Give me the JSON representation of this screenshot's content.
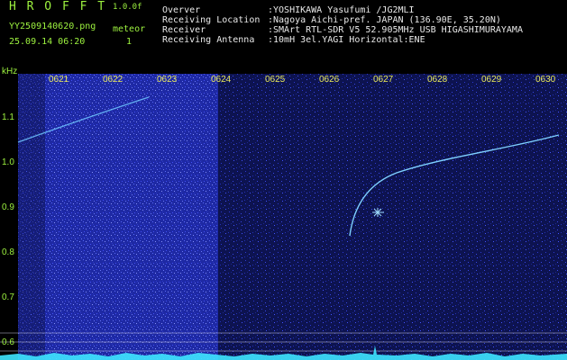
{
  "header": {
    "brand": "H R O F F T",
    "version": "1.0.0f",
    "filename": "YY2509140620.png",
    "datetime": "25.09.14 06:20",
    "meteor_label": "meteor",
    "meteor_count": "1",
    "info_labels": [
      "Overver",
      "Receiving Location",
      "Receiver",
      "Receiving Antenna"
    ],
    "info_values": [
      ":YOSHIKAWA Yasufumi /JG2MLI",
      ":Nagoya Aichi-pref. JAPAN (136.90E, 35.20N)",
      ":SMArt RTL-SDR V5 52.905MHz USB HIGASHIMURAYAMA",
      ":10mH 3el.YAGI Horizontal:ENE"
    ]
  },
  "spectrogram": {
    "unit_label": "kHz",
    "y_ticks": [
      "1.1",
      "1.0",
      "0.9",
      "0.8",
      "0.7",
      "0.6"
    ],
    "x_ticks": [
      "0621",
      "0622",
      "0623",
      "0624",
      "0625",
      "0626",
      "0627",
      "0628",
      "0629",
      "0630"
    ],
    "colors": {
      "background": "#0a0f3a",
      "noise_bright": "#3a4cff",
      "trail": "#6fc6ff",
      "ticks_x": "#e8e85a",
      "ticks_y": "#9df23f",
      "baseline": "#3ee6ff"
    }
  }
}
